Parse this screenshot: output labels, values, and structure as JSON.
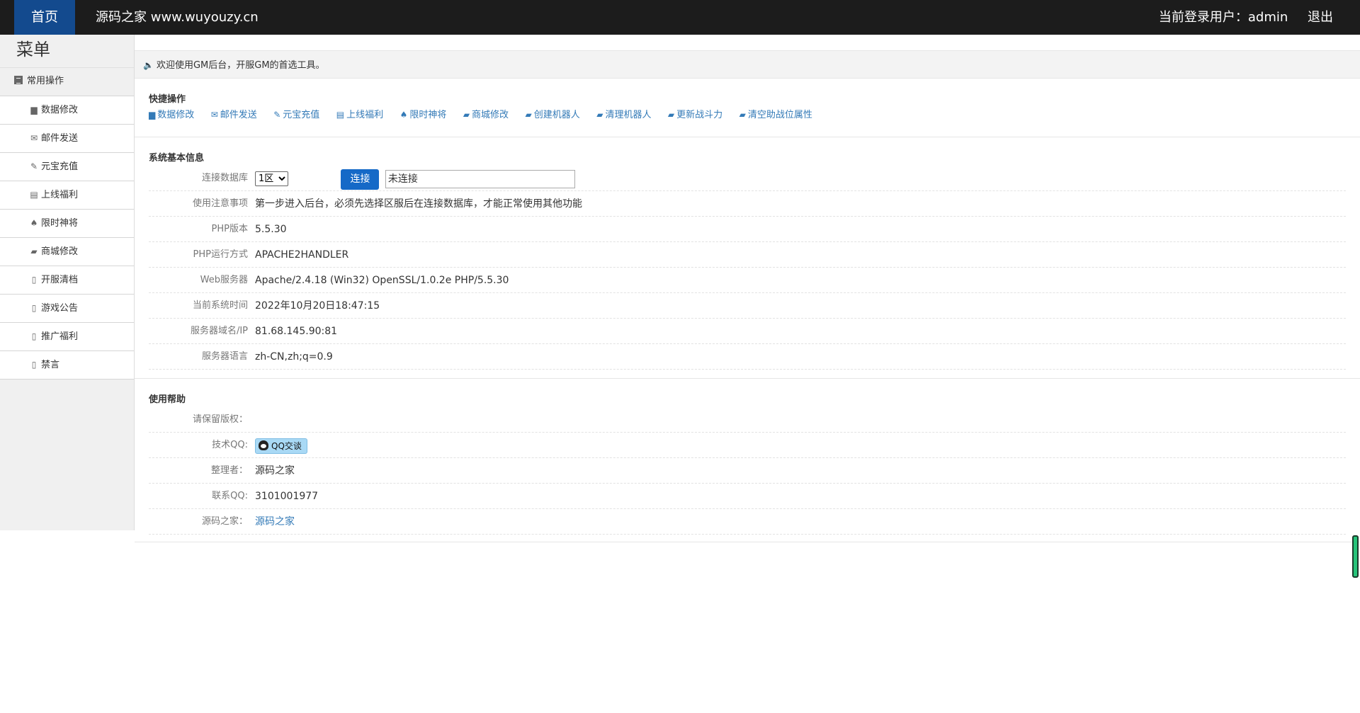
{
  "topbar": {
    "home_label": "首页",
    "site_title": "源码之家 www.wuyouzy.cn",
    "user_label": "当前登录用户：admin",
    "logout_label": "退出"
  },
  "sidebar": {
    "menu_title": "菜单",
    "group_label": "常用操作",
    "items": [
      {
        "label": "数据修改",
        "icon": "truck-icon"
      },
      {
        "label": "邮件发送",
        "icon": "envelope-icon"
      },
      {
        "label": "元宝充值",
        "icon": "wrench-icon"
      },
      {
        "label": "上线福利",
        "icon": "list-icon"
      },
      {
        "label": "限时神将",
        "icon": "spade-icon"
      },
      {
        "label": "商城修改",
        "icon": "folder-icon"
      },
      {
        "label": "开服清档",
        "icon": "file-icon"
      },
      {
        "label": "游戏公告",
        "icon": "file-icon"
      },
      {
        "label": "推广福利",
        "icon": "file-icon"
      },
      {
        "label": "禁言",
        "icon": "file-icon"
      }
    ]
  },
  "welcome": "欢迎使用GM后台，开服GM的首选工具。",
  "quick_ops": {
    "title": "快捷操作",
    "links": [
      {
        "label": "数据修改",
        "icon": "truck-icon"
      },
      {
        "label": "邮件发送",
        "icon": "envelope-icon"
      },
      {
        "label": "元宝充值",
        "icon": "wrench-icon"
      },
      {
        "label": "上线福利",
        "icon": "list-icon"
      },
      {
        "label": "限时神将",
        "icon": "spade-icon"
      },
      {
        "label": "商城修改",
        "icon": "folder-icon"
      },
      {
        "label": "创建机器人",
        "icon": "folder-icon"
      },
      {
        "label": "清理机器人",
        "icon": "folder-icon"
      },
      {
        "label": "更新战斗力",
        "icon": "folder-icon"
      },
      {
        "label": "清空助战位属性",
        "icon": "folder-icon"
      }
    ]
  },
  "sys_info": {
    "title": "系统基本信息",
    "db_label": "连接数据库",
    "db_selected": "1区",
    "connect_label": "连接",
    "conn_status": "未连接",
    "rows": [
      {
        "label": "使用注意事项",
        "value": "第一步进入后台，必须先选择区服后在连接数据库，才能正常使用其他功能"
      },
      {
        "label": "PHP版本",
        "value": "5.5.30"
      },
      {
        "label": "PHP运行方式",
        "value": "APACHE2HANDLER"
      },
      {
        "label": "Web服务器",
        "value": "Apache/2.4.18 (Win32) OpenSSL/1.0.2e PHP/5.5.30"
      },
      {
        "label": "当前系统时间",
        "value": "2022年10月20日18:47:15"
      },
      {
        "label": "服务器域名/IP",
        "value": "81.68.145.90:81"
      },
      {
        "label": "服务器语言",
        "value": "zh-CN,zh;q=0.9"
      }
    ]
  },
  "help": {
    "title": "使用帮助",
    "copyright_label": "请保留版权：",
    "qq_label": "技术QQ:",
    "qq_button": "QQ交谈",
    "organizer_label": "整理者：",
    "organizer_value": "源码之家",
    "contact_label": "联系QQ:",
    "contact_value": "3101001977",
    "site_label": "源码之家：",
    "site_value": "源码之家"
  }
}
